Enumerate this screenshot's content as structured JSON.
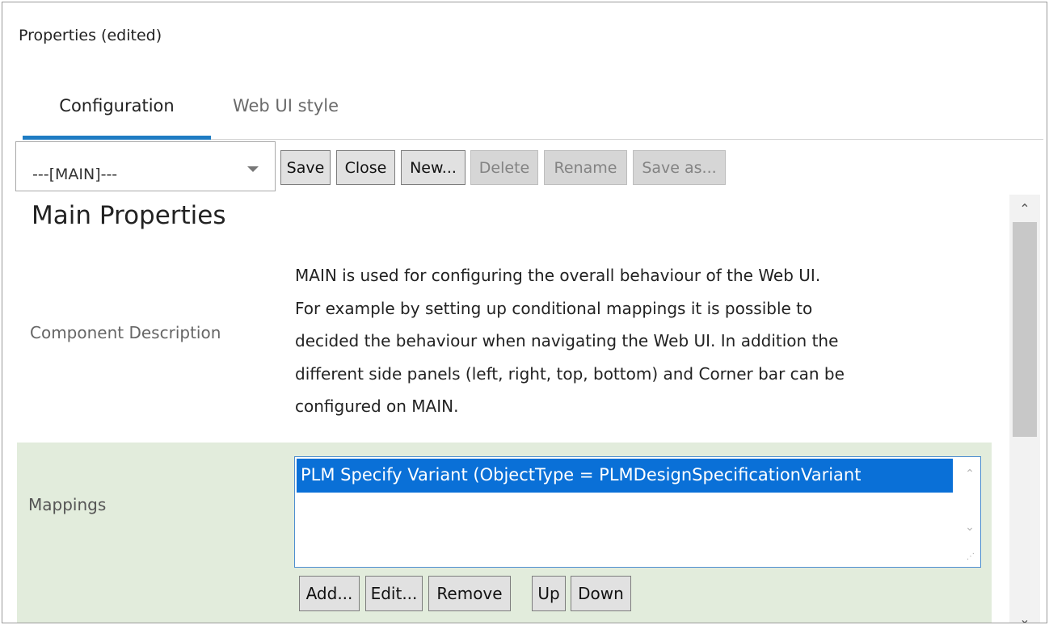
{
  "window": {
    "title": "Properties (edited)"
  },
  "tabs": [
    {
      "label": "Configuration",
      "active": true
    },
    {
      "label": "Web UI style",
      "active": false
    }
  ],
  "toolbar": {
    "select_value": "---[MAIN]---",
    "buttons": [
      {
        "label": "Save",
        "enabled": true
      },
      {
        "label": "Close",
        "enabled": true
      },
      {
        "label": "New...",
        "enabled": true
      },
      {
        "label": "Delete",
        "enabled": false
      },
      {
        "label": "Rename",
        "enabled": false
      },
      {
        "label": "Save as...",
        "enabled": false
      }
    ]
  },
  "main": {
    "section_title": "Main Properties",
    "component_description_label": "Component Description",
    "component_description_lines": [
      "MAIN is used for configuring the overall behaviour of the Web UI.",
      "For example by setting up conditional mappings it is possible to",
      "decided the behaviour when navigating the Web UI. In addition the",
      "different side panels (left, right, top, bottom) and Corner bar can be",
      "configured on MAIN."
    ],
    "mappings_label": "Mappings",
    "mappings_items": [
      "PLM Specify Variant (ObjectType = PLMDesignSpecificationVariant"
    ],
    "mapping_buttons": [
      "Add...",
      "Edit...",
      "Remove",
      "Up",
      "Down"
    ]
  },
  "colors": {
    "accent": "#1f7cc3",
    "selection": "#0a70d7",
    "mapping_background": "#e2ecdc"
  },
  "icons": {
    "select_caret": "chevron-down-icon",
    "scroll_up": "chevron-up-icon",
    "scroll_down": "chevron-down-icon",
    "resize_grip": "resize-grip-icon"
  }
}
